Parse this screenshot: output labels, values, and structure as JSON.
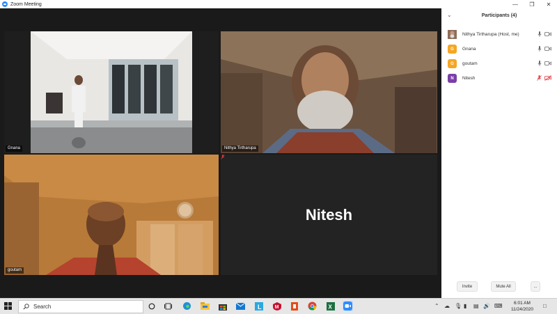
{
  "window": {
    "title": "Zoom Meeting"
  },
  "tiles": [
    {
      "name": "Gnana"
    },
    {
      "name": "Nithya Tirtharupa"
    },
    {
      "name": "goutam"
    },
    {
      "display_name": "Nitesh"
    }
  ],
  "participants": {
    "title": "Participants (4)",
    "people": [
      {
        "name": "Nithya Tirtharupa (Host, me)",
        "avatar_type": "photo",
        "mic": "on",
        "video": "on"
      },
      {
        "name": "Gnana",
        "initial": "G",
        "avatar_color": "#f5a623",
        "mic": "on",
        "video": "on"
      },
      {
        "name": "goutam",
        "initial": "G",
        "avatar_color": "#f5a623",
        "mic": "on",
        "video": "on"
      },
      {
        "name": "Nitesh",
        "initial": "N",
        "avatar_color": "#7b3fa8",
        "mic": "muted",
        "video": "off"
      }
    ],
    "invite_label": "Invite",
    "mute_all_label": "Mute All",
    "more_label": "..."
  },
  "taskbar": {
    "search_label": "Search",
    "time": "6:01 AM",
    "date": "11/24/2020"
  },
  "colors": {
    "active_speaker": "#c8d84c",
    "muted": "#e0343f"
  }
}
